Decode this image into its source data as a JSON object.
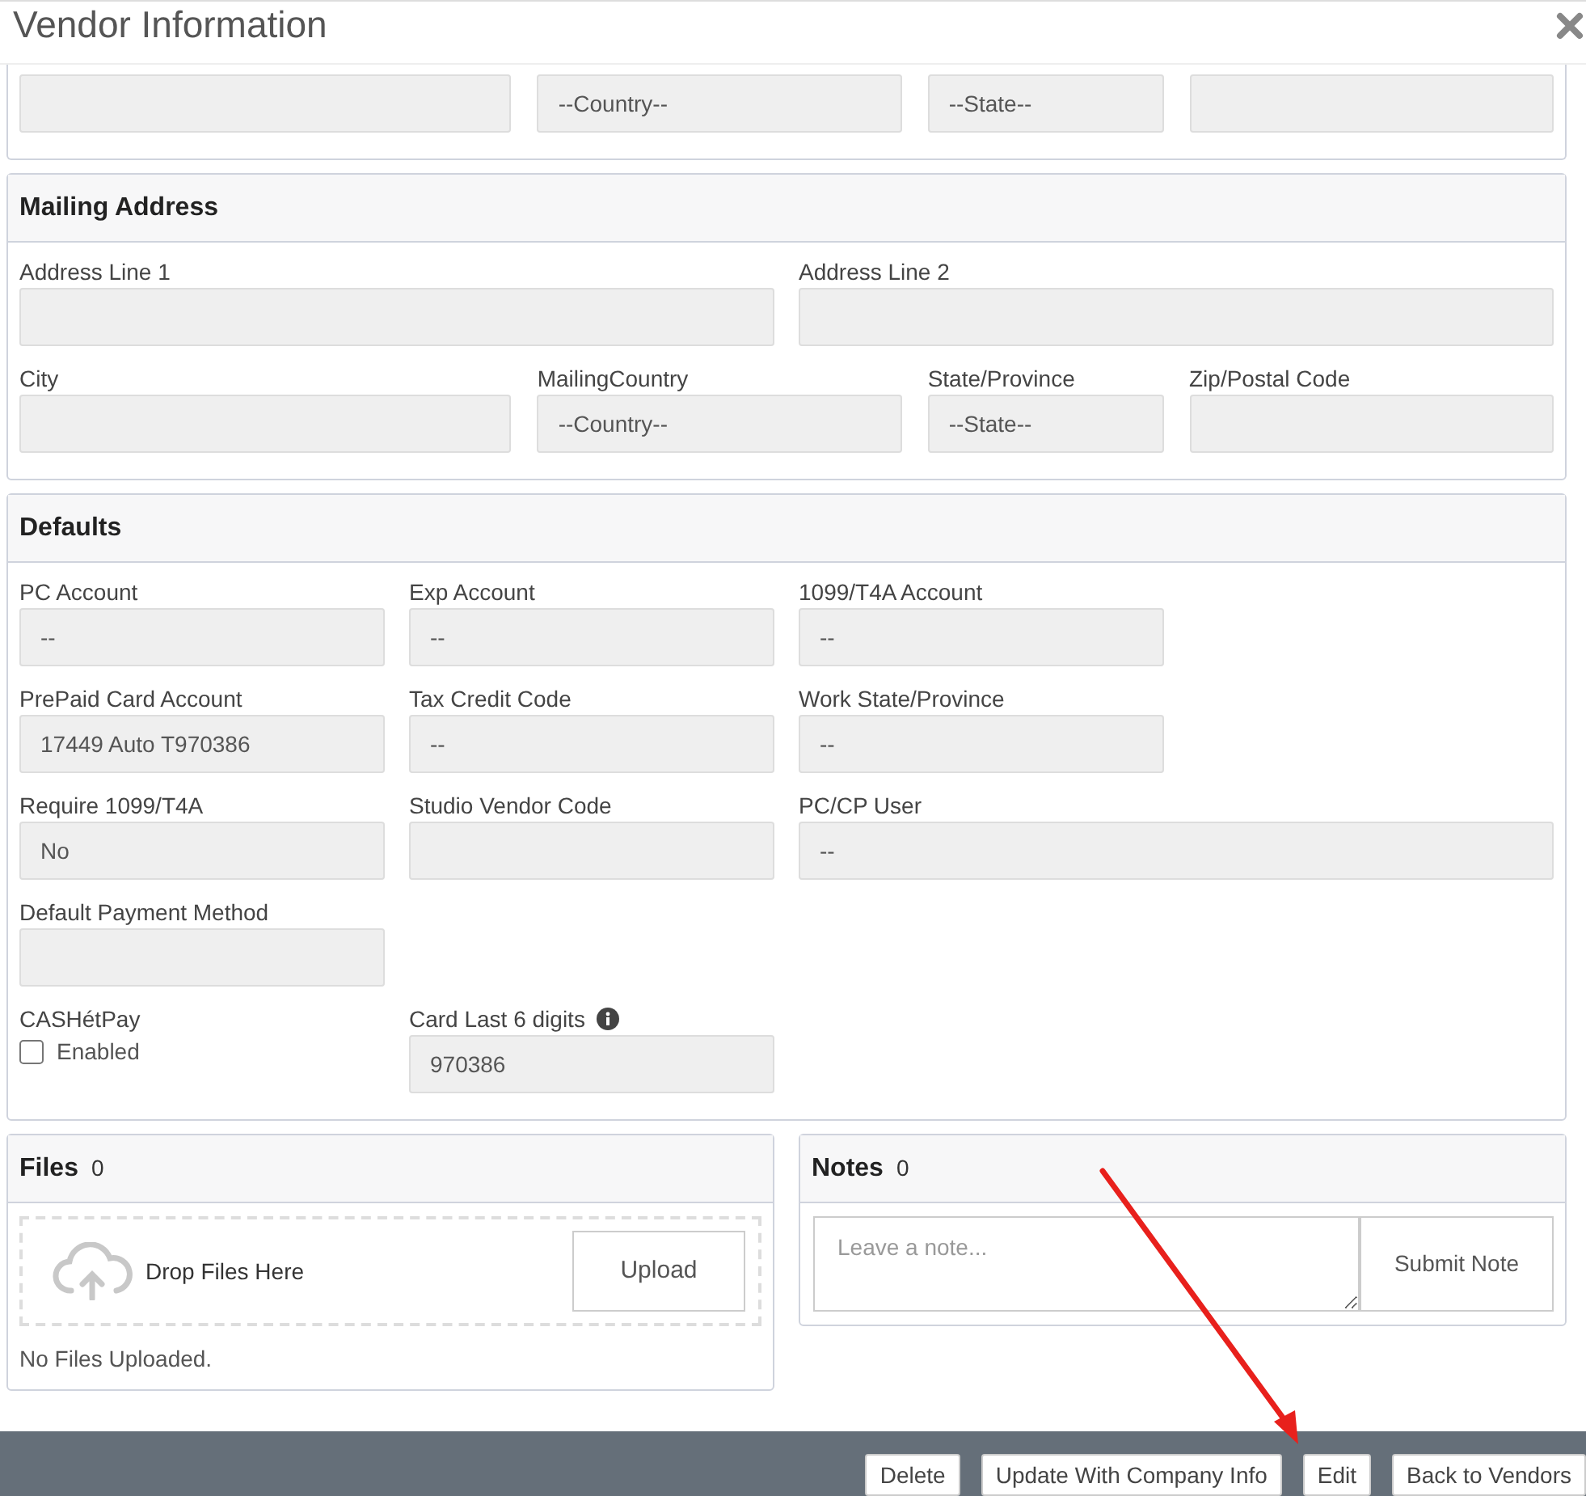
{
  "window": {
    "title": "Vendor Information"
  },
  "address_fields": [
    {
      "kind": "field"
    },
    {
      "kind": "field",
      "value": "--Country--"
    },
    {
      "kind": "field",
      "value": "--State--"
    },
    {
      "kind": "field"
    }
  ],
  "mailing_address": {
    "title": "Mailing Address",
    "rows": [
      [
        {
          "label": "Address Line 1",
          "kind": "field"
        },
        {
          "label": "Address Line 2",
          "kind": "field"
        }
      ],
      [
        {
          "label": "City",
          "kind": "field"
        },
        {
          "label": "MailingCountry",
          "kind": "field",
          "value": "--Country--"
        },
        {
          "label": "State/Province",
          "kind": "field",
          "value": "--State--"
        },
        {
          "label": "Zip/Postal Code",
          "kind": "field"
        }
      ]
    ]
  },
  "defaults": {
    "title": "Defaults",
    "rows": [
      [
        {
          "label": "PC Account",
          "kind": "field",
          "value": "--"
        },
        {
          "label": "Exp Account",
          "kind": "field",
          "value": "--"
        },
        {
          "label": "1099/T4A Account",
          "kind": "field",
          "value": "--"
        }
      ],
      [
        {
          "label": "PrePaid Card Account",
          "kind": "field",
          "value": "17449 Auto T970386"
        },
        {
          "label": "Tax Credit Code",
          "kind": "field",
          "value": "--"
        },
        {
          "label": "Work State/Province",
          "kind": "field",
          "value": "--"
        }
      ],
      [
        {
          "label": "Require 1099/T4A",
          "kind": "field",
          "value": "No"
        },
        {
          "label": "Studio Vendor Code",
          "kind": "field"
        },
        {
          "label": "PC/CP User",
          "kind": "field",
          "value": "--"
        }
      ],
      [
        {
          "label": "Default Payment Method",
          "kind": "field"
        }
      ],
      [
        {
          "label": "CASHétPay",
          "kind": "checkbox",
          "option": "Enabled",
          "checked": false
        },
        {
          "label": "Card Last 6 digits",
          "kind": "field",
          "value": "970386",
          "info_icon": true
        }
      ]
    ]
  },
  "files": {
    "title": "Files",
    "count": "0",
    "drop_text": "Drop Files Here",
    "upload_button": "Upload",
    "empty_text": "No Files Uploaded."
  },
  "notes": {
    "title": "Notes",
    "count": "0",
    "placeholder": "Leave a note...",
    "submit_button": "Submit Note"
  },
  "footer_buttons": [
    "Delete",
    "Update With Company Info",
    "Edit",
    "Back to Vendors"
  ]
}
